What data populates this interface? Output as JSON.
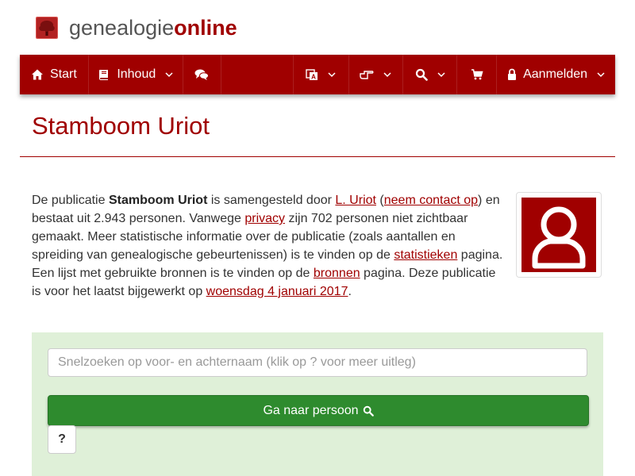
{
  "site": {
    "name_part1": "genealogie",
    "name_part2": "online"
  },
  "nav": {
    "start": "Start",
    "contents": "Inhoud",
    "login": "Aanmelden",
    "icons": [
      "home-icon",
      "book-icon",
      "comments-icon",
      "language-icon",
      "hand-point-icon",
      "search-icon",
      "cart-icon",
      "lock-icon"
    ]
  },
  "page": {
    "title": "Stamboom Uriot"
  },
  "intro": {
    "t1": "De publicatie ",
    "pub_name": "Stamboom Uriot",
    "t2": " is samengesteld door ",
    "author_link": "L. Uriot",
    "t3": " (",
    "contact_link": "neem contact op",
    "t4": ") en bestaat uit 2.943 personen. Vanwege ",
    "privacy_link": "privacy",
    "t5": " zijn 702 personen niet zichtbaar gemaakt. Meer statistische informatie over de publicatie (zoals aantallen en spreiding van genealogische gebeurtenissen) is te vinden op de ",
    "stats_link": "statistieken",
    "t6": " pagina. Een lijst met gebruikte bronnen is te vinden op de ",
    "sources_link": "bronnen",
    "t7": " pagina. Deze publicatie is voor het laatst bijgewerkt op ",
    "date_link": "woensdag 4 januari 2017",
    "t8": "."
  },
  "search": {
    "placeholder": "Snelzoeken op voor- en achternaam (klik op ? voor meer uitleg)",
    "button_label": "Ga naar persoon",
    "help_label": "?"
  },
  "colors": {
    "brand": "#a00000",
    "panel": "#dff0d8",
    "button": "#2e8b2e"
  }
}
